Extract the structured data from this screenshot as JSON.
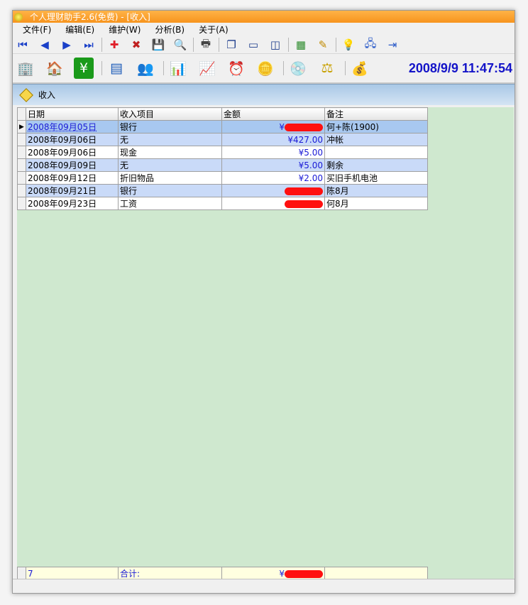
{
  "window": {
    "title": "个人理财助手2.6(免费) - [收入]"
  },
  "menu": [
    "文件(F)",
    "编辑(E)",
    "维护(W)",
    "分析(B)",
    "关于(A)"
  ],
  "toolbar1": {
    "icons": [
      "first-record-icon",
      "prev-record-icon",
      "next-record-icon",
      "last-record-icon",
      "add-icon",
      "delete-icon",
      "save-icon",
      "preview-icon",
      "print-icon",
      "cascade-icon",
      "window-icon",
      "tile-icon",
      "excel-icon",
      "note-icon",
      "tip-icon",
      "network-icon",
      "exit-icon"
    ],
    "glyphs": [
      "⏮",
      "◀",
      "▶",
      "⏭",
      "✚",
      "✖",
      "💾",
      "🔍",
      "🖶",
      "❐",
      "▭",
      "◫",
      "▦",
      "✎",
      "💡",
      "🖧",
      "⇥"
    ],
    "colors": [
      "#1a40c8",
      "#1a40c8",
      "#1a40c8",
      "#1a40c8",
      "#e0202a",
      "#c02020",
      "#c89a00",
      "#2a5a9a",
      "#444444",
      "#1a3a8a",
      "#1a3a8a",
      "#1a3a8a",
      "#2a8a2a",
      "#c08a00",
      "#e8b400",
      "#2a5ac8",
      "#2a5ac8"
    ]
  },
  "toolbar2": {
    "icons": [
      "building-icon",
      "house-icon",
      "yen-icon",
      "table-icon",
      "people-icon",
      "bar-chart-icon",
      "chart-table-icon",
      "alarm-clock-icon",
      "coins-icon",
      "disk-icon",
      "balance-icon",
      "money-bag-icon"
    ],
    "glyphs": [
      "🏢",
      "🏠",
      "¥",
      "▤",
      "👥",
      "📊",
      "📈",
      "⏰",
      "🪙",
      "💿",
      "⚖",
      "💰"
    ],
    "colors": [
      "#2a6ac8",
      "#3a7a3a",
      "#ffffff",
      "#1a5ab8",
      "#a05a20",
      "#c82020",
      "#1a8a1a",
      "#e02020",
      "#c89a00",
      "#5a6aa8",
      "#c8a000",
      "#2a8a2a"
    ],
    "bgs": [
      "transparent",
      "transparent",
      "#1a9a1a",
      "transparent",
      "transparent",
      "transparent",
      "transparent",
      "transparent",
      "transparent",
      "transparent",
      "transparent",
      "transparent"
    ]
  },
  "clock": "2008/9/9 11:47:54",
  "panel": {
    "title": "收入"
  },
  "table": {
    "headers": [
      "日期",
      "收入项目",
      "金额",
      "备注"
    ],
    "rows": [
      {
        "date": "2008年09月05日",
        "item": "银行",
        "amount": "¥",
        "amount_redacted": true,
        "note": "何+陈(1900)"
      },
      {
        "date": "2008年09月06日",
        "item": "无",
        "amount": "¥427.00",
        "amount_redacted": false,
        "note": "冲帐"
      },
      {
        "date": "2008年09月06日",
        "item": "现金",
        "amount": "¥5.00",
        "amount_redacted": false,
        "note": ""
      },
      {
        "date": "2008年09月09日",
        "item": "无",
        "amount": "¥5.00",
        "amount_redacted": false,
        "note": "剩余"
      },
      {
        "date": "2008年09月12日",
        "item": "折旧物品",
        "amount": "¥2.00",
        "amount_redacted": false,
        "note": "买旧手机电池"
      },
      {
        "date": "2008年09月21日",
        "item": "银行",
        "amount": "",
        "amount_redacted": true,
        "note": "陈8月"
      },
      {
        "date": "2008年09月23日",
        "item": "工资",
        "amount": "",
        "amount_redacted": true,
        "note": "何8月"
      }
    ],
    "footer": {
      "count": "7",
      "label": "合计:",
      "amount": "¥",
      "amount_redacted": true,
      "note": ""
    }
  }
}
